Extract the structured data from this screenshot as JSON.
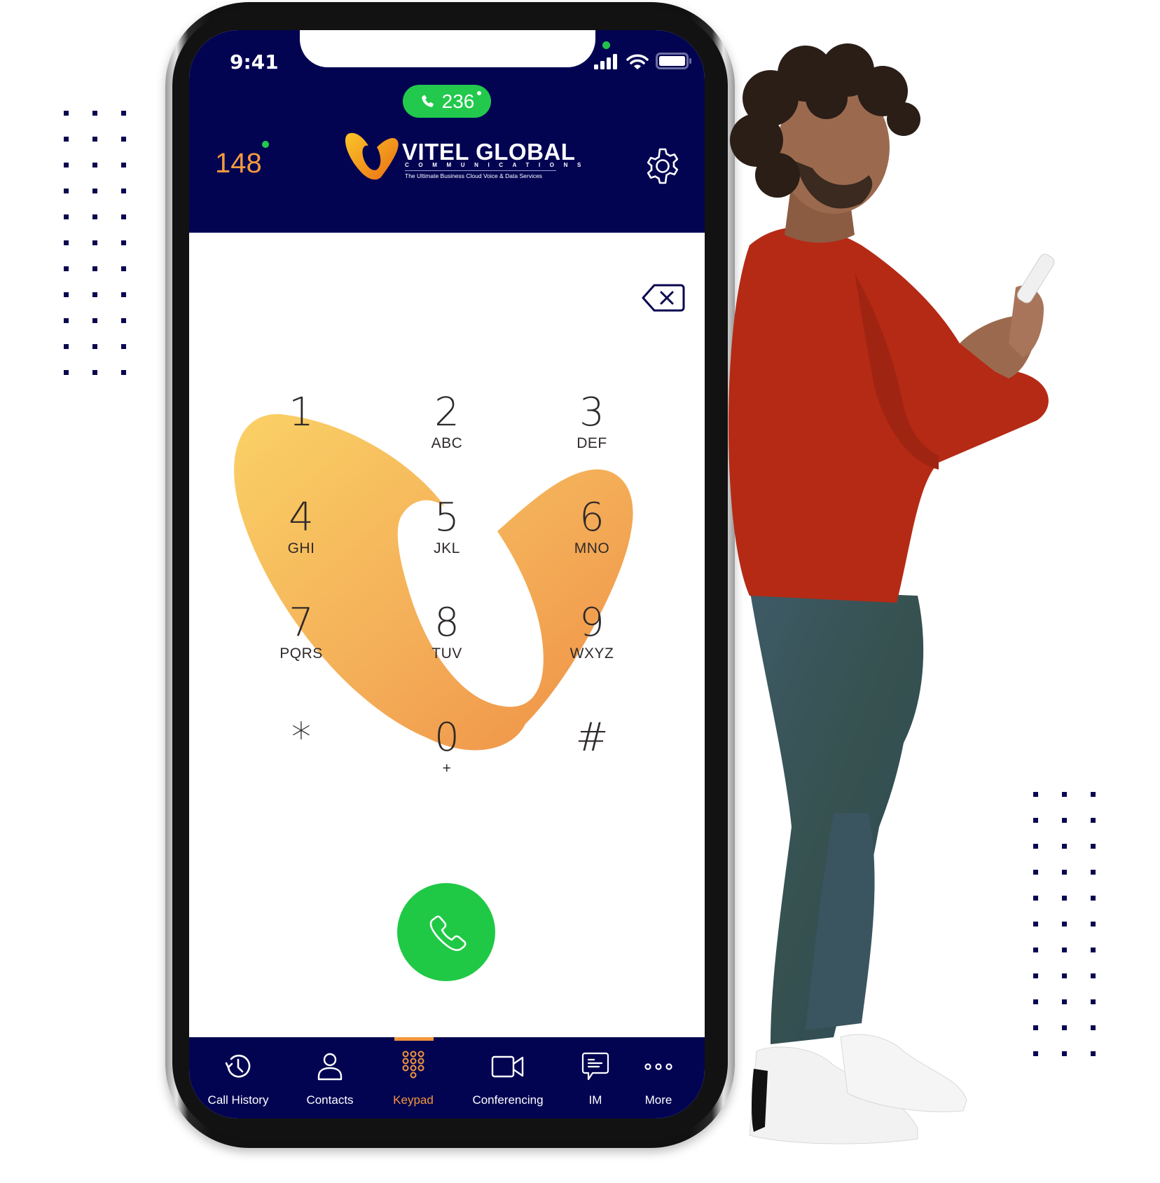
{
  "status_bar": {
    "time": "9:41",
    "signal_icon": "signal-bars-icon",
    "wifi_icon": "wifi-icon",
    "battery_icon": "battery-icon"
  },
  "header": {
    "active_calls": "236",
    "extension": "148",
    "extension_status": "online",
    "logo": {
      "title": "VITEL GLOBAL",
      "subtitle": "COMMUNICATIONS",
      "tagline": "The Ultimate Business Cloud Voice & Data Services"
    },
    "settings_icon": "gear-icon"
  },
  "dialer": {
    "input_value": "",
    "backspace_icon": "backspace-icon",
    "keys": [
      {
        "digit": "1",
        "letters": ""
      },
      {
        "digit": "2",
        "letters": "ABC"
      },
      {
        "digit": "3",
        "letters": "DEF"
      },
      {
        "digit": "4",
        "letters": "GHI"
      },
      {
        "digit": "5",
        "letters": "JKL"
      },
      {
        "digit": "6",
        "letters": "MNO"
      },
      {
        "digit": "7",
        "letters": "PQRS"
      },
      {
        "digit": "8",
        "letters": "TUV"
      },
      {
        "digit": "9",
        "letters": "WXYZ"
      },
      {
        "digit": "*",
        "letters": ""
      },
      {
        "digit": "0",
        "letters": "+"
      },
      {
        "digit": "#",
        "letters": ""
      }
    ],
    "call_icon": "phone-icon"
  },
  "nav": {
    "active": "Keypad",
    "items": [
      {
        "label": "Call History",
        "icon": "clock-history-icon"
      },
      {
        "label": "Contacts",
        "icon": "person-icon"
      },
      {
        "label": "Keypad",
        "icon": "keypad-icon"
      },
      {
        "label": "Conferencing",
        "icon": "video-camera-icon"
      },
      {
        "label": "IM",
        "icon": "chat-bubble-icon"
      },
      {
        "label": "More",
        "icon": "more-dots-icon"
      }
    ]
  },
  "colors": {
    "brand_navy": "#020452",
    "accent_orange": "#f3963c",
    "call_green": "#20c945",
    "online_green": "#22c94c"
  }
}
